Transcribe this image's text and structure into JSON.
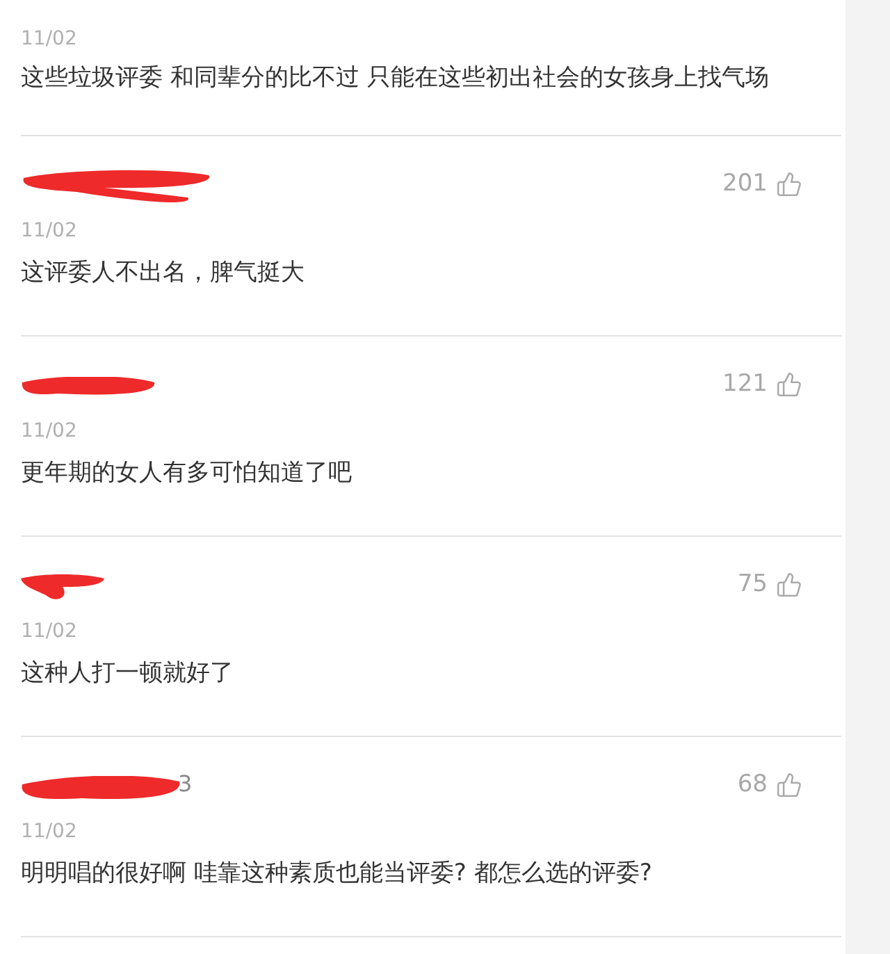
{
  "comments": [
    {
      "date": "11/02",
      "text": "这些垃圾评委 和同辈分的比不过 只能在这些初出社会的女孩身上找气场"
    },
    {
      "redacted": true,
      "likes": "201",
      "date": "11/02",
      "text": "这评委人不出名，脾气挺大"
    },
    {
      "redacted": true,
      "likes": "121",
      "date": "11/02",
      "text": "更年期的女人有多可怕知道了吧"
    },
    {
      "redacted": true,
      "likes": "75",
      "date": "11/02",
      "text": "这种人打一顿就好了"
    },
    {
      "redacted": true,
      "name": "3",
      "likes": "68",
      "date": "11/02",
      "text": "明明唱的很好啊 哇靠这种素质也能当评委? 都怎么选的评委?"
    }
  ]
}
